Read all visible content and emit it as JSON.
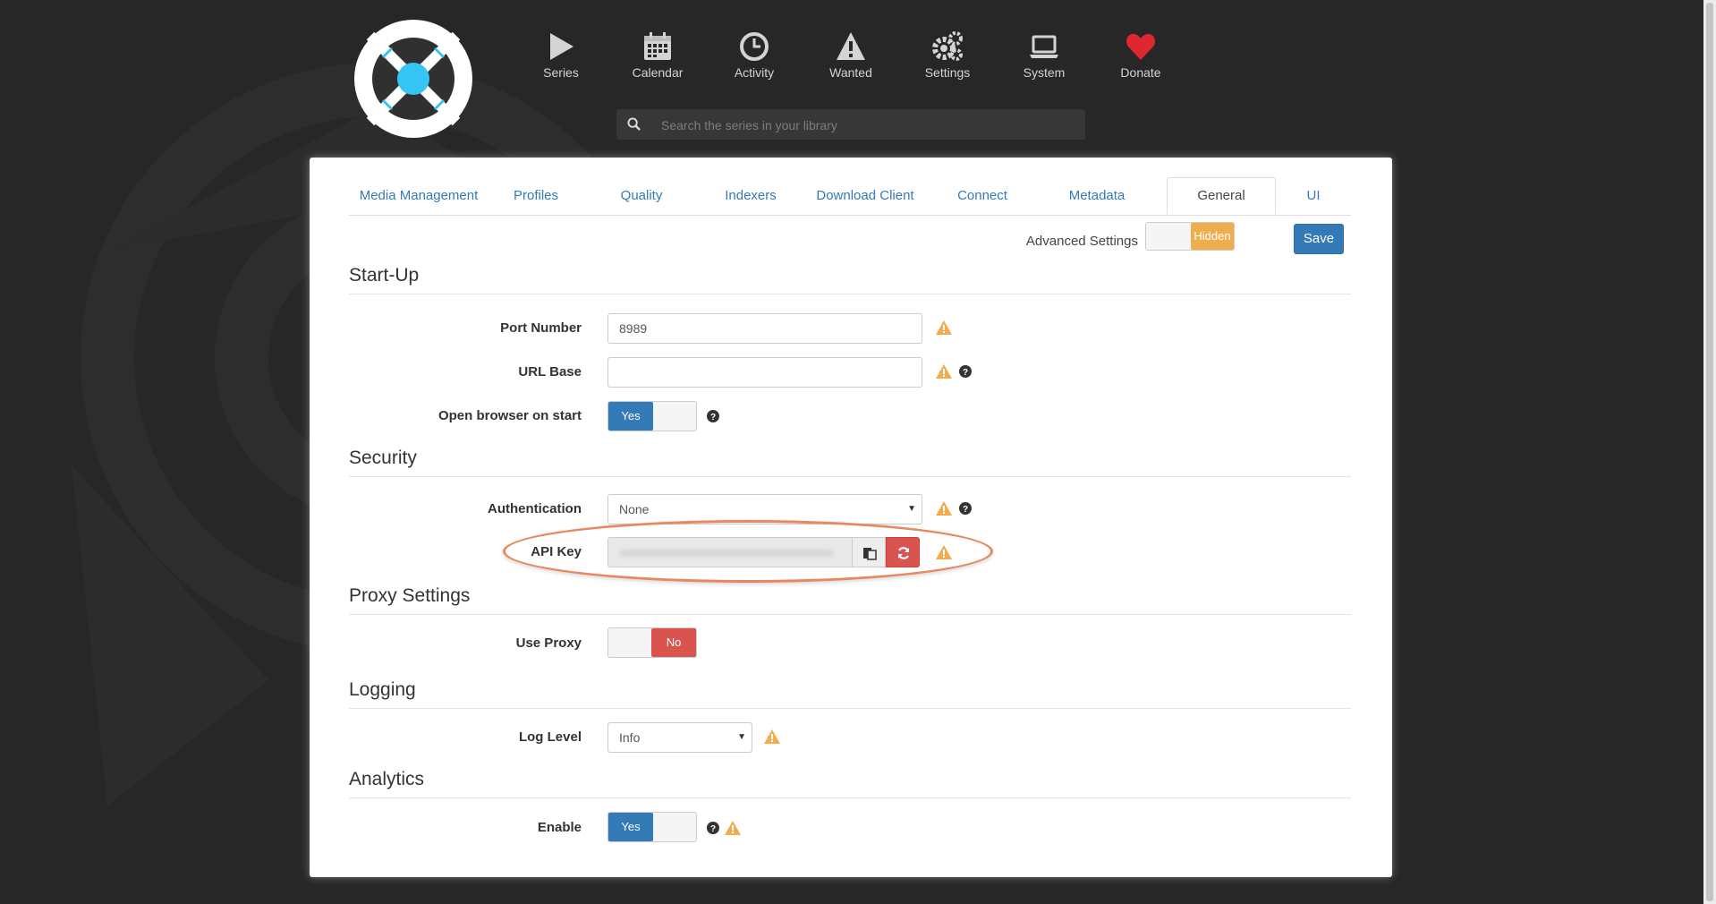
{
  "nav": [
    {
      "label": "Series",
      "icon": "play-icon"
    },
    {
      "label": "Calendar",
      "icon": "calendar-icon"
    },
    {
      "label": "Activity",
      "icon": "clock-icon"
    },
    {
      "label": "Wanted",
      "icon": "warning-icon"
    },
    {
      "label": "Settings",
      "icon": "gears-icon"
    },
    {
      "label": "System",
      "icon": "laptop-icon"
    },
    {
      "label": "Donate",
      "icon": "heart-icon"
    }
  ],
  "search": {
    "placeholder": "Search the series in your library"
  },
  "tabs": [
    "Media Management",
    "Profiles",
    "Quality",
    "Indexers",
    "Download Client",
    "Connect",
    "Metadata",
    "General",
    "UI"
  ],
  "active_tab": "General",
  "toolbar": {
    "advanced_label": "Advanced Settings",
    "advanced_state": "Hidden",
    "save_label": "Save"
  },
  "sections": {
    "startup": {
      "title": "Start-Up",
      "port_label": "Port Number",
      "port_value": "8989",
      "urlbase_label": "URL Base",
      "urlbase_value": "",
      "browser_label": "Open browser on start",
      "browser_state": "Yes"
    },
    "security": {
      "title": "Security",
      "auth_label": "Authentication",
      "auth_value": "None",
      "apikey_label": "API Key"
    },
    "proxy": {
      "title": "Proxy Settings",
      "use_label": "Use Proxy",
      "use_state": "No"
    },
    "logging": {
      "title": "Logging",
      "level_label": "Log Level",
      "level_value": "Info"
    },
    "analytics": {
      "title": "Analytics",
      "enable_label": "Enable",
      "enable_state": "Yes"
    }
  },
  "colors": {
    "accent": "#337ab7",
    "warning": "#f0ad4e",
    "danger": "#d9534f",
    "donate": "#e0272f",
    "logo_blue": "#35c5f4"
  }
}
